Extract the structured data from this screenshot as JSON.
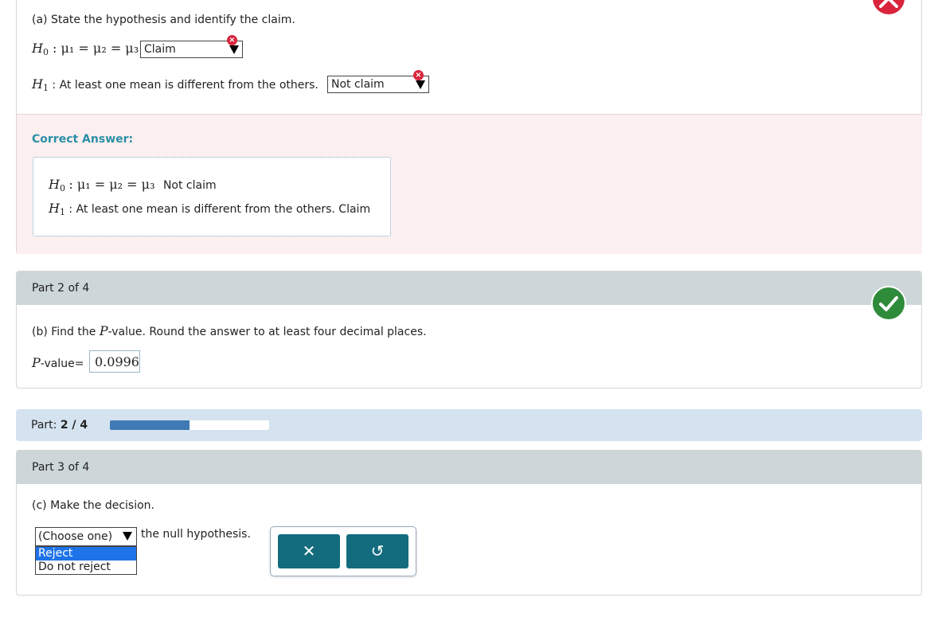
{
  "part1": {
    "question": "(a) State the hypothesis and identify the claim.",
    "h0_label": "H",
    "h0_sub": "0",
    "h0_expr": ": μ₁ = μ₂ = μ₃",
    "h0_selected": "Claim",
    "h1_label": "H",
    "h1_sub": "1",
    "h1_text": ": At least one mean is different from the others.",
    "h1_selected": "Not claim",
    "incorrect_mark": "×",
    "correct_answer_label": "Correct Answer:",
    "answer_h0_expr": ": μ₁ = μ₂ = μ₃",
    "answer_h0_claim": "Not claim",
    "answer_h1_text": ": At least one mean is different from the others. Claim"
  },
  "part2": {
    "header": "Part 2 of 4",
    "question_prefix": "(b) Find the",
    "question_p": "P",
    "question_suffix": "-value. Round the answer to at least four decimal places.",
    "pvalue_label_p": "P",
    "pvalue_label_rest": "-value",
    "equals": "=",
    "pvalue": "0.0996"
  },
  "progress": {
    "label": "Part:",
    "value_text": "2 / 4",
    "fraction": 0.5,
    "colors": {
      "fill": "#3f7ab4",
      "track": "#ffffff"
    }
  },
  "part3": {
    "header": "Part 3 of 4",
    "question": "(c) Make the decision.",
    "select_placeholder": "(Choose one)",
    "after_select": "the null hypothesis.",
    "options": [
      "Reject",
      "Do not reject"
    ],
    "highlighted_option": "Reject",
    "clear_symbol": "✕",
    "reset_symbol": "↺"
  },
  "colors": {
    "incorrect": "#d9243c",
    "correct": "#2e8b3a",
    "answer_label": "#2a8fa8",
    "tool_button": "#136b7e"
  }
}
